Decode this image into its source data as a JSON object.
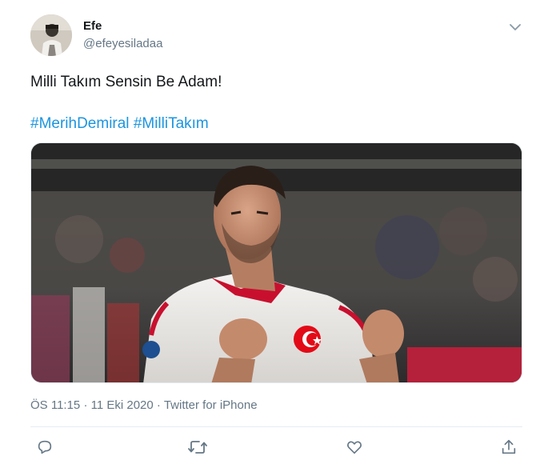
{
  "user": {
    "display_name": "Efe",
    "handle": "@efeyesiladaa"
  },
  "tweet": {
    "text": "Milli Takım Sensin Be Adam!",
    "hashtags": [
      "#MerihDemiral",
      "#MilliTakım"
    ]
  },
  "meta": {
    "time": "ÖS 11:15",
    "date": "11 Eki 2020",
    "separator": "·",
    "source": "Twitter for iPhone"
  },
  "actions": {
    "reply": "reply-icon",
    "retweet": "retweet-icon",
    "like": "heart-icon",
    "share": "share-icon"
  },
  "colors": {
    "link": "#1b95e0",
    "secondary_text": "#657786",
    "icon": "#657786"
  }
}
